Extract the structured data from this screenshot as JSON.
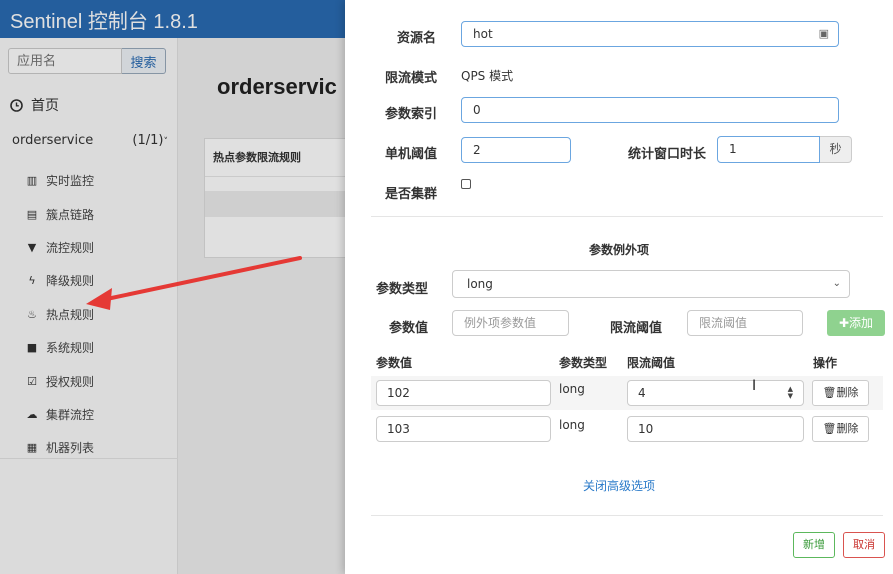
{
  "app": {
    "title": "Sentinel 控制台 1.8.1"
  },
  "sidebar": {
    "search_placeholder": "应用名",
    "search_button": "搜索",
    "home_label": "首页",
    "app_name": "orderservice",
    "app_count": "(1/1)",
    "items": [
      {
        "label": "实时监控",
        "icon": "bar-chart-icon"
      },
      {
        "label": "簇点链路",
        "icon": "list-icon"
      },
      {
        "label": "流控规则",
        "icon": "filter-icon"
      },
      {
        "label": "降级规则",
        "icon": "bolt-icon"
      },
      {
        "label": "热点规则",
        "icon": "fire-icon"
      },
      {
        "label": "系统规则",
        "icon": "lock-icon"
      },
      {
        "label": "授权规则",
        "icon": "check-square-icon"
      },
      {
        "label": "集群流控",
        "icon": "cloud-icon"
      },
      {
        "label": "机器列表",
        "icon": "grid-icon"
      }
    ]
  },
  "main": {
    "title": "orderservic",
    "panel_title": "热点参数限流规则"
  },
  "modal": {
    "resource_label": "资源名",
    "resource_value": "hot",
    "mode_label": "限流模式",
    "mode_value": "QPS 模式",
    "param_index_label": "参数索引",
    "param_index_value": "0",
    "threshold_label": "单机阈值",
    "threshold_value": "2",
    "window_label": "统计窗口时长",
    "window_value": "1",
    "window_unit": "秒",
    "cluster_label": "是否集群",
    "cluster_checked": false,
    "exception_title": "参数例外项",
    "param_type_label": "参数类型",
    "param_type_value": "long",
    "param_value_label": "参数值",
    "param_value_placeholder": "例外项参数值",
    "limit_label": "限流阈值",
    "limit_placeholder": "限流阈值",
    "add_button": "添加",
    "table_headers": [
      "参数值",
      "参数类型",
      "限流阈值",
      "操作"
    ],
    "rows": [
      {
        "value": "102",
        "type": "long",
        "limit": "4",
        "delete": "删除"
      },
      {
        "value": "103",
        "type": "long",
        "limit": "10",
        "delete": "删除"
      }
    ],
    "toggle_link": "关闭高级选项",
    "save_button": "新增",
    "cancel_button": "取消"
  },
  "colors": {
    "brand": "#2a6bb3",
    "focus_border": "#6ba6e0",
    "add_button": "#8fd28f",
    "save_border": "#5cb85c",
    "cancel_border": "#d9534f",
    "arrow": "#e53935"
  }
}
